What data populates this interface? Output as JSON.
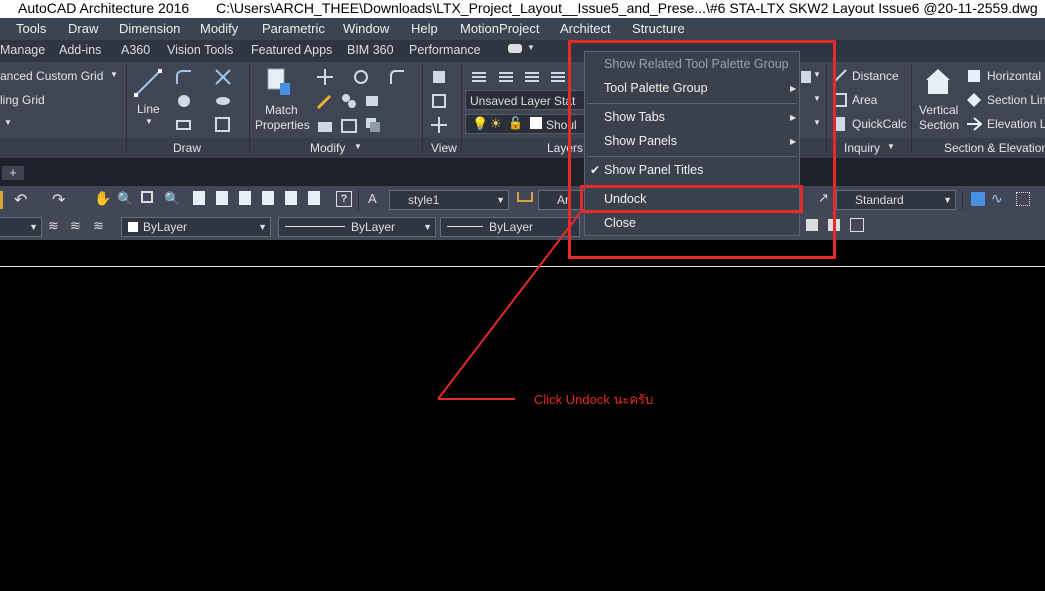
{
  "window": {
    "app_title": "AutoCAD Architecture 2016",
    "file_path": "C:\\Users\\ARCH_THEE\\Downloads\\LTX_Project_Layout__Issue5_and_Prese...\\#6 STA-LTX SKW2 Layout Issue6 @20-11-2559.dwg"
  },
  "menubar": [
    "Tools",
    "Draw",
    "Dimension",
    "Modify",
    "Parametric",
    "Window",
    "Help",
    "MotionProject",
    "Architect",
    "Structure"
  ],
  "tabs": [
    "Manage",
    "Add-ins",
    "A360",
    "Vision Tools",
    "Featured Apps",
    "BIM 360",
    "Performance"
  ],
  "ribbon": {
    "grid_items": [
      "anced Custom Grid",
      "ling Grid"
    ],
    "draw": {
      "line_label": "Line",
      "panel_title": "Draw"
    },
    "modify": {
      "match_label_1": "Match",
      "match_label_2": "Properties",
      "panel_title": "Modify"
    },
    "view": {
      "panel_title": "View"
    },
    "layers": {
      "layer_state": "Unsaved Layer Stat",
      "layer_name": "Shoul",
      "panel_title": "Layers"
    },
    "inquiry": {
      "distance": "Distance",
      "area": "Area",
      "quickcalc": "QuickCalc",
      "panel_title": "Inquiry"
    },
    "section": {
      "vertical_1": "Vertical",
      "vertical_2": "Section",
      "horizontal": "Horizontal",
      "section_line": "Section Lin",
      "elevation": "Elevation L",
      "panel_title": "Section & Elevation"
    }
  },
  "toolbar1": {
    "text_style": "style1",
    "dim_style_partial": "Ari",
    "table_style": "Standard"
  },
  "toolbar2": {
    "layer_color": "ByLayer",
    "linetype": "ByLayer",
    "lineweight": "ByLayer"
  },
  "context_menu": {
    "items": [
      {
        "label": "Show Related Tool Palette Group",
        "disabled": true
      },
      {
        "label": "Tool Palette Group",
        "submenu": true
      },
      {
        "label": "Show Tabs",
        "submenu": true
      },
      {
        "label": "Show Panels",
        "submenu": true
      },
      {
        "label": "Show Panel Titles",
        "checked": true
      },
      {
        "label": "Undock"
      },
      {
        "label": "Close"
      }
    ]
  },
  "annotation": "Click Undock นะครับ",
  "colors": {
    "highlight": "#e52a2a",
    "ribbon": "#3f4553",
    "canvas": "#000000"
  }
}
